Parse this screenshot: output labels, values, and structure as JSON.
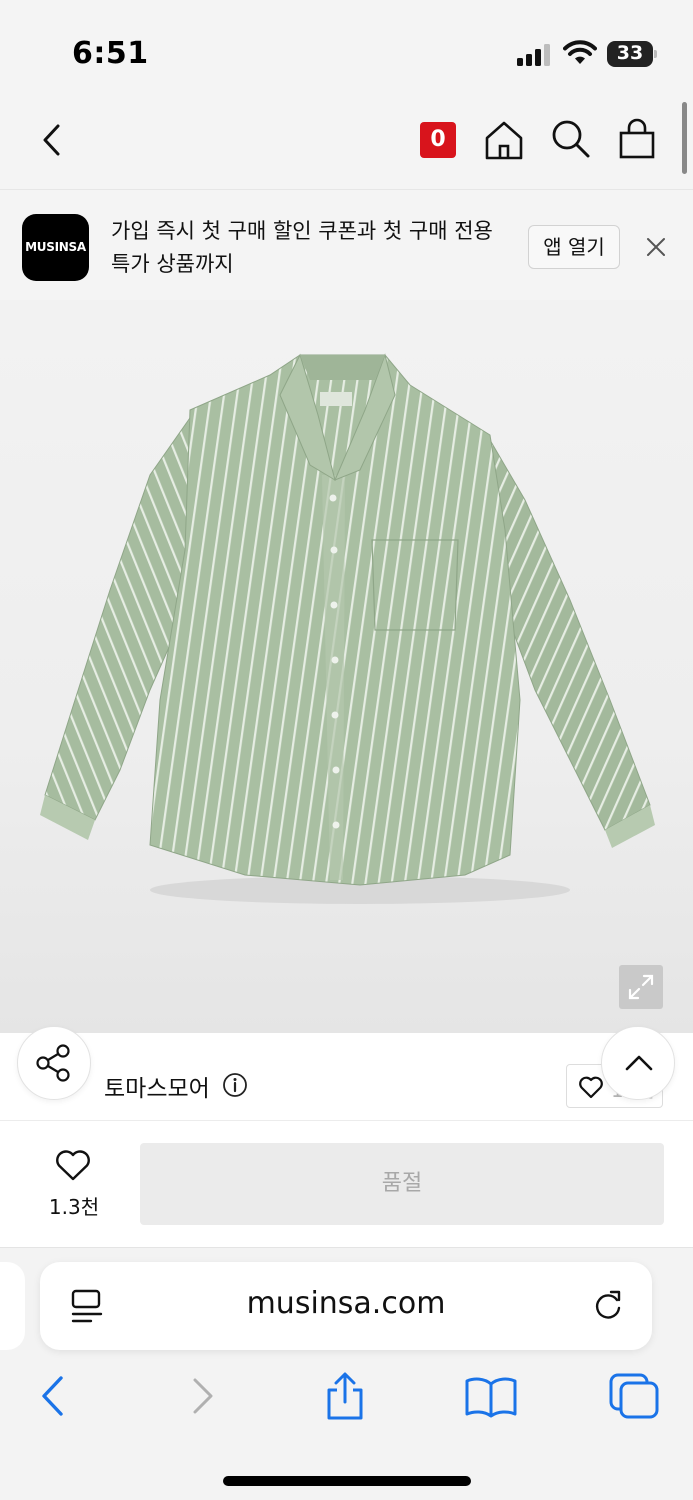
{
  "status_bar": {
    "time": "6:51",
    "battery": "33",
    "icons": [
      "signal-icon",
      "wifi-icon",
      "battery-icon"
    ]
  },
  "nav": {
    "back_icon": "chevron-left-icon",
    "cart_badge": "0",
    "icons": [
      "home-icon",
      "search-icon",
      "shopping-bag-icon"
    ],
    "badge_color": "#d8141c"
  },
  "banner": {
    "logo_text": "MUSINSA",
    "message": "가입 즉시 첫 구매 할인 쿠폰과 첫 구매 전용 특가 상품까지",
    "open_app_label": "앱 열기",
    "close_icon": "close-icon"
  },
  "product": {
    "image_icon": "striped-shirt-image",
    "expand_icon": "expand-icon",
    "shirt_color": "#a9bfa2"
  },
  "brand": {
    "name": "토마스모어",
    "info_icon": "info-icon",
    "like_count": "11만"
  },
  "actions": {
    "share_icon": "share-icon",
    "scroll_top_icon": "chevron-up-icon"
  },
  "buy_bar": {
    "wish_count": "1.3천",
    "soldout_label": "품절"
  },
  "safari": {
    "url": "musinsa.com",
    "icons": [
      "reader-icon",
      "reload-icon",
      "back-arrow-icon",
      "forward-arrow-icon",
      "share-icon",
      "bookmarks-icon",
      "tabs-icon"
    ],
    "accent": "#1a73e8"
  }
}
